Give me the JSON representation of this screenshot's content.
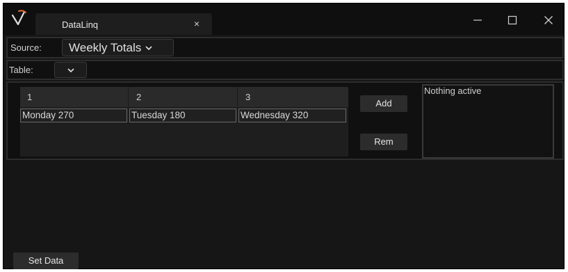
{
  "window": {
    "tab_title": "DataLinq",
    "tab_close": "×"
  },
  "source": {
    "label": "Source:",
    "selected": "Weekly Totals"
  },
  "table": {
    "label": "Table:",
    "selected": ""
  },
  "grid": {
    "columns": [
      "1",
      "2",
      "3"
    ],
    "rows": [
      [
        "Monday 270",
        "Tuesday 180",
        "Wednesday 320"
      ]
    ]
  },
  "actions": {
    "add_label": "Add",
    "remove_label": "Rem",
    "set_data_label": "Set Data"
  },
  "status": {
    "text": "Nothing active"
  },
  "colors": {
    "accent": "#e8703a",
    "background": "#161616"
  }
}
